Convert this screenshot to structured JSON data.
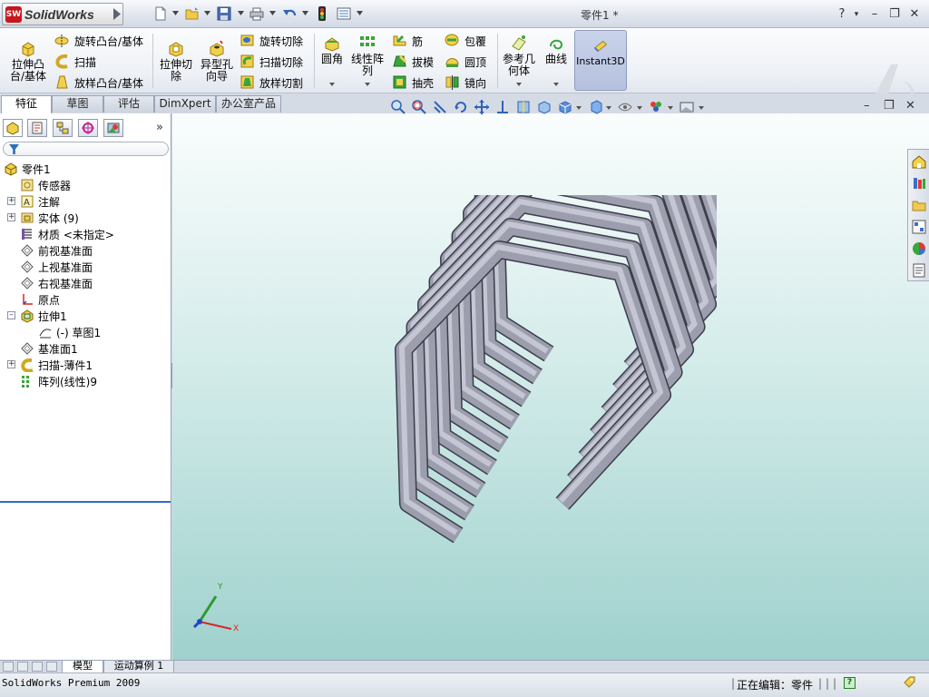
{
  "app": {
    "brand": "SolidWorks",
    "brand_badge": "SW",
    "document_title": "零件1 *",
    "help": "?",
    "help_dd": "▾",
    "minimize": "–",
    "restore": "❐",
    "close": "✕"
  },
  "quick_access": [
    "new-icon",
    "open-icon",
    "save-icon",
    "print-icon",
    "undo-icon",
    "rebuild-icon",
    "options-icon"
  ],
  "command_manager": {
    "extrude_boss": "拉伸凸\n台/基体",
    "revolve_boss": "旋转凸台/基体",
    "sweep": "扫描",
    "loft": "放样凸台/基体",
    "extrude_cut": "拉伸切\n除",
    "hole_wizard": "异型孔\n向导",
    "revolve_cut": "旋转切除",
    "sweep_cut": "扫描切除",
    "loft_cut": "放样切割",
    "fillet": "圆角",
    "linear_pattern": "线性阵\n列",
    "rib": "筋",
    "draft": "拔模",
    "shell": "抽壳",
    "wrap": "包覆",
    "dome": "圆顶",
    "mirror": "镜向",
    "ref_geometry": "参考几\n何体",
    "curves": "曲线",
    "instant3d": "Instant3D"
  },
  "tabs": [
    {
      "label": "特征",
      "active": true
    },
    {
      "label": "草图",
      "active": false
    },
    {
      "label": "评估",
      "active": false
    },
    {
      "label": "DimXpert",
      "active": false
    },
    {
      "label": "办公室产品",
      "active": false
    }
  ],
  "panel": {
    "more": "»",
    "tabs": [
      "feature-manager-icon",
      "property-manager-icon",
      "configuration-manager-icon",
      "dimxpert-manager-icon",
      "display-manager-icon"
    ]
  },
  "tree": [
    {
      "label": "零件1",
      "icon": "part-icon",
      "indent": 0,
      "expander": ""
    },
    {
      "label": "传感器",
      "icon": "sensor-icon",
      "indent": 1,
      "expander": ""
    },
    {
      "label": "注解",
      "icon": "annotations-icon",
      "indent": 1,
      "expander": "+"
    },
    {
      "label": "实体 (9)",
      "icon": "solid-bodies-icon",
      "indent": 1,
      "expander": "+"
    },
    {
      "label": "材质 <未指定>",
      "icon": "material-icon",
      "indent": 1,
      "expander": ""
    },
    {
      "label": "前视基准面",
      "icon": "plane-icon",
      "indent": 1,
      "expander": ""
    },
    {
      "label": "上视基准面",
      "icon": "plane-icon",
      "indent": 1,
      "expander": ""
    },
    {
      "label": "右视基准面",
      "icon": "plane-icon",
      "indent": 1,
      "expander": ""
    },
    {
      "label": "原点",
      "icon": "origin-icon",
      "indent": 1,
      "expander": ""
    },
    {
      "label": "拉伸1",
      "icon": "extrude-icon",
      "indent": 1,
      "expander": "–"
    },
    {
      "label": "(-) 草图1",
      "icon": "sketch-icon",
      "indent": 2,
      "expander": ""
    },
    {
      "label": "基准面1",
      "icon": "plane-icon",
      "indent": 1,
      "expander": ""
    },
    {
      "label": "扫描-薄件1",
      "icon": "sweep-icon",
      "indent": 1,
      "expander": "+"
    },
    {
      "label": "阵列(线性)9",
      "icon": "linear-pattern-icon",
      "indent": 1,
      "expander": ""
    }
  ],
  "view_toolbar": [
    "zoom-to-fit-icon",
    "zoom-to-area-icon",
    "previous-view-icon",
    "rotate-icon",
    "pan-icon",
    "normal-to-icon",
    "section-view-icon",
    "view-orientation-icon",
    "display-style-icon",
    "hide-show-icon",
    "edit-appearance-icon",
    "apply-scene-icon"
  ],
  "task_pane": [
    "solidworks-resources-icon",
    "design-library-icon",
    "file-explorer-icon",
    "view-palette-icon",
    "appearances-icon",
    "custom-properties-icon"
  ],
  "triad": {
    "x": "X",
    "y": "Y"
  },
  "bottom_tabs": [
    {
      "label": "模型",
      "active": true
    },
    {
      "label": "运动算例 1",
      "active": false
    }
  ],
  "status": {
    "product": "SolidWorks Premium 2009",
    "editing": "正在编辑：零件",
    "help": "?"
  }
}
